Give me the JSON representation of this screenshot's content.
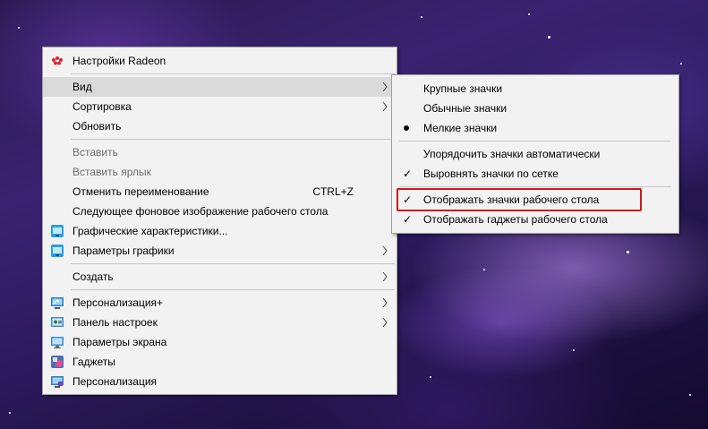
{
  "desktop": {
    "wallpaper": "purple-galaxy"
  },
  "context_menu": {
    "items": [
      {
        "label": "Настройки Radeon",
        "icon": "radeon-icon"
      },
      {
        "label": "Вид",
        "submenu": true
      },
      {
        "label": "Сортировка",
        "submenu": true
      },
      {
        "label": "Обновить"
      },
      {
        "label": "Вставить",
        "disabled": true
      },
      {
        "label": "Вставить ярлык",
        "disabled": true
      },
      {
        "label": "Отменить переименование",
        "shortcut": "CTRL+Z"
      },
      {
        "label": "Следующее фоновое изображение рабочего стола"
      },
      {
        "label": "Графические характеристики...",
        "icon": "intel-graphics-icon"
      },
      {
        "label": "Параметры графики",
        "icon": "intel-graphics-icon",
        "submenu": true
      },
      {
        "label": "Создать",
        "submenu": true
      },
      {
        "label": "Персонализация+",
        "icon": "personalization-plus-icon",
        "submenu": true
      },
      {
        "label": "Панель настроек",
        "icon": "control-panel-icon",
        "submenu": true
      },
      {
        "label": "Параметры экрана",
        "icon": "display-icon"
      },
      {
        "label": "Гаджеты",
        "icon": "gadgets-icon"
      },
      {
        "label": "Персонализация",
        "icon": "personalization-icon"
      }
    ]
  },
  "view_submenu": {
    "items": [
      {
        "label": "Крупные значки"
      },
      {
        "label": "Обычные значки"
      },
      {
        "label": "Мелкие значки",
        "state": "radio-selected"
      },
      {
        "label": "Упорядочить значки автоматически"
      },
      {
        "label": "Выровнять значки по сетке",
        "state": "checked"
      },
      {
        "label": "Отображать значки рабочего стола",
        "state": "checked",
        "highlighted": true
      },
      {
        "label": "Отображать гаджеты  рабочего стола",
        "state": "checked"
      }
    ],
    "check_glyph": "✓"
  },
  "colors": {
    "menu_bg": "#f2f2f2",
    "hover_bg": "#dadada",
    "disabled_text": "#6d6d6d",
    "highlight_border": "#d0121e"
  }
}
